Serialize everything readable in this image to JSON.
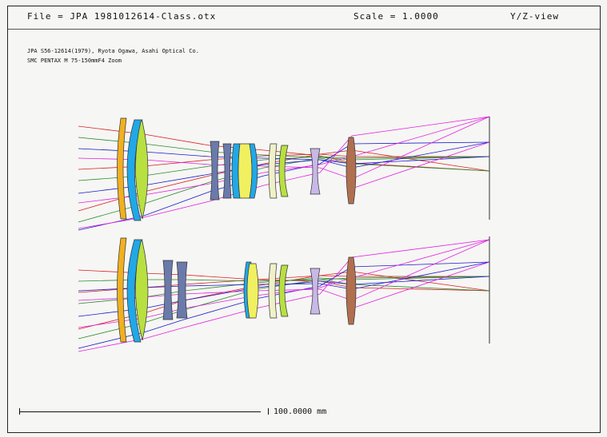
{
  "header": {
    "file": "File = JPA 1981012614-Class.otx",
    "scale": "Scale = 1.0000",
    "view": "Y/Z-view"
  },
  "notes": {
    "line1": "JPA S56-12614(1979), Ryota Ogawa, Asahi Optical Co.",
    "line2": "SMC PENTAX M 75-150mmF4 Zoom"
  },
  "scale_bar": {
    "label": "100.0000 mm"
  },
  "colors": {
    "ray_red": "#d82020",
    "ray_green": "#2a8a2a",
    "ray_blue": "#1a1acc",
    "ray_magenta": "#e020e0",
    "glass_orange": "#f0b020",
    "glass_cyan": "#20a8e8",
    "glass_yellowgreen": "#b8e040",
    "glass_slate": "#6a7aaa",
    "glass_yellow": "#f0f060",
    "glass_pale": "#f0f0c8",
    "glass_lavender": "#c8b8e8",
    "glass_brown": "#b07050"
  }
}
